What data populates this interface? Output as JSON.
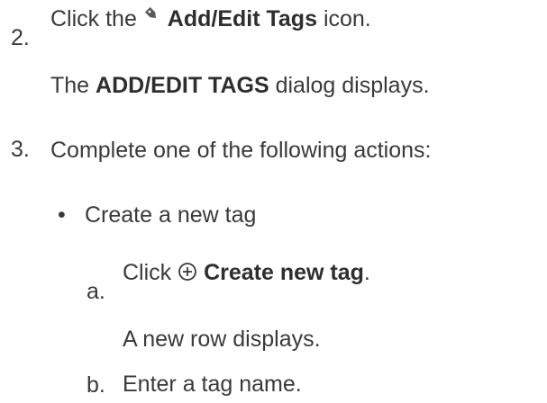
{
  "steps": [
    {
      "number": "2.",
      "text_before": "Click the",
      "icon": "tag-icon",
      "bold_label": "Add/Edit Tags",
      "text_after": "icon.",
      "result_before": "The",
      "result_bold": "ADD/EDIT TAGS",
      "result_after": "dialog displays."
    },
    {
      "number": "3.",
      "text": "Complete one of the following actions:",
      "bullets": [
        {
          "bullet": "•",
          "text": "Create a new tag",
          "substeps": [
            {
              "number": "a.",
              "text_before": "Click",
              "icon": "plus-circle-icon",
              "bold_label": "Create new tag",
              "text_after": ".",
              "result": "A new row displays."
            },
            {
              "number": "b.",
              "text": "Enter a tag name."
            }
          ]
        }
      ]
    }
  ],
  "colors": {
    "text": "#3a3a3a",
    "bold_text": "#2e2e2e"
  }
}
